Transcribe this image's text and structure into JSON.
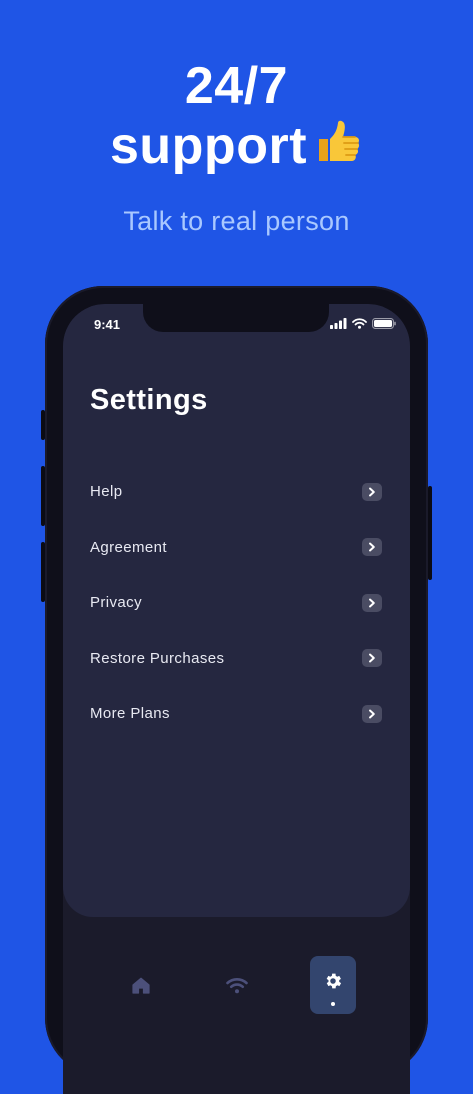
{
  "promo": {
    "headline_line1": "24/7",
    "headline_line2": "support",
    "headline_emoji": "thumbs-up",
    "tagline": "Talk to real person"
  },
  "colors": {
    "background": "#1f55e6",
    "tagline": "#a9c8ff",
    "panel": "#252740",
    "screen": "#1b1b2b",
    "active_tab": "#33456e"
  },
  "status_bar": {
    "time": "9:41",
    "icons": [
      "signal-icon",
      "wifi-icon",
      "battery-icon"
    ]
  },
  "settings": {
    "title": "Settings",
    "items": [
      {
        "label": "Help",
        "icon": "chevron-right-icon"
      },
      {
        "label": "Agreement",
        "icon": "chevron-right-icon"
      },
      {
        "label": "Privacy",
        "icon": "chevron-right-icon"
      },
      {
        "label": "Restore Purchases",
        "icon": "chevron-right-icon"
      },
      {
        "label": "More Plans",
        "icon": "chevron-right-icon"
      }
    ]
  },
  "tab_bar": {
    "tabs": [
      {
        "icon": "home-icon",
        "active": false
      },
      {
        "icon": "wifi-icon",
        "active": false
      },
      {
        "icon": "gear-icon",
        "active": true
      }
    ]
  }
}
